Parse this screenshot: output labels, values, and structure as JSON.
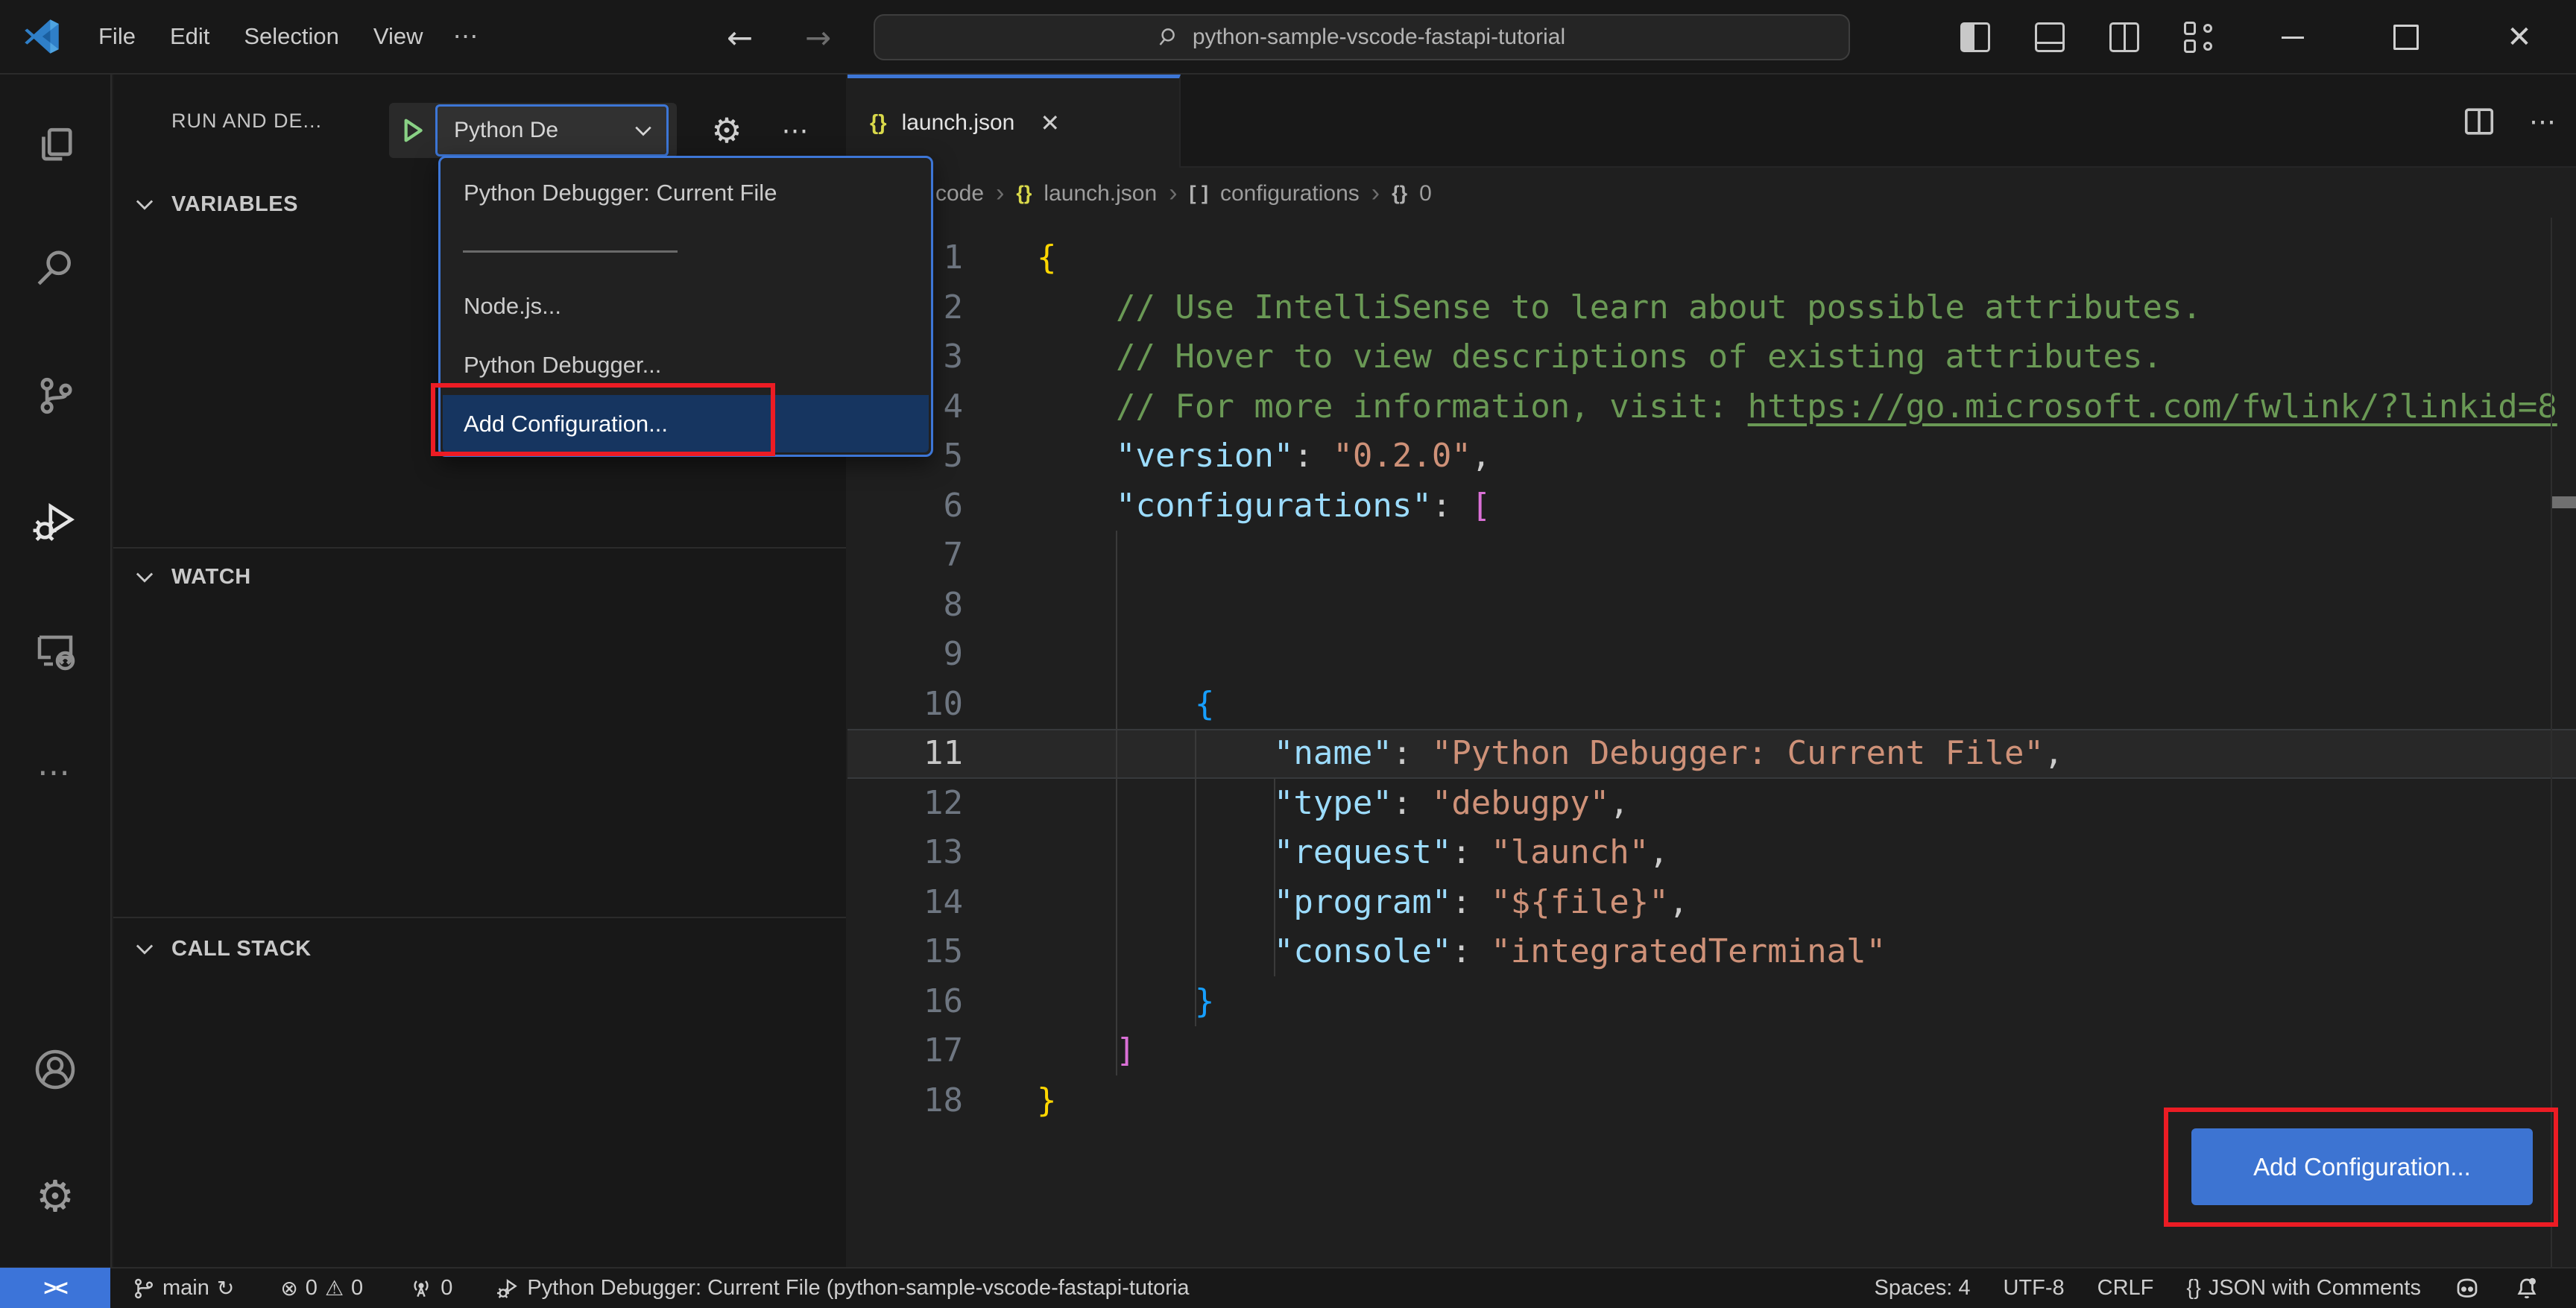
{
  "titlebar": {
    "menus": [
      "File",
      "Edit",
      "Selection",
      "View"
    ],
    "more_label": "⋯",
    "back_arrow": "←",
    "forward_arrow": "→",
    "search_value": "python-sample-vscode-fastapi-tutorial"
  },
  "activity_bar": {
    "items": [
      "explorer",
      "search",
      "source-control",
      "run-and-debug",
      "remote-explorer",
      "more"
    ],
    "bottom_items": [
      "account",
      "settings"
    ],
    "active_item": "run-and-debug",
    "settings_glyph": "⚙",
    "more_glyph": "⋯"
  },
  "sidebar": {
    "title": "RUN AND DE...",
    "run_select_value": "Python De",
    "gear_glyph": "⚙",
    "more_glyph": "⋯",
    "sections": [
      {
        "label": "VARIABLES"
      },
      {
        "label": "WATCH"
      },
      {
        "label": "CALL STACK"
      }
    ]
  },
  "debug_dropdown": {
    "items": [
      "Python Debugger: Current File",
      "Node.js...",
      "Python Debugger...",
      "Add Configuration..."
    ],
    "selected_item": "Add Configuration..."
  },
  "editor": {
    "tab": {
      "icon": "{}",
      "label": "launch.json",
      "close": "✕"
    },
    "breadcrumbs": [
      {
        "sym": "",
        "label": "code"
      },
      {
        "sym": "{}",
        "label": "launch.json"
      },
      {
        "sym": "[ ]",
        "label": "configurations"
      },
      {
        "sym": "{}",
        "label": "0"
      }
    ],
    "crumb_sep": "›",
    "current_line": 11,
    "lines": [
      [
        {
          "t": "{",
          "c": "b1"
        }
      ],
      [
        {
          "t": "    // Use IntelliSense to learn about possible attributes.",
          "c": "cm"
        }
      ],
      [
        {
          "t": "    // Hover to view descriptions of existing attributes.",
          "c": "cm"
        }
      ],
      [
        {
          "t": "    // For more information, visit: ",
          "c": "cm"
        },
        {
          "t": "https://go.microsoft.com/fwlink/?linkid=8",
          "c": "lk"
        }
      ],
      [
        {
          "t": "    ",
          "c": "p"
        },
        {
          "t": "\"version\"",
          "c": "k"
        },
        {
          "t": ": ",
          "c": "p"
        },
        {
          "t": "\"0.2.0\"",
          "c": "s"
        },
        {
          "t": ",",
          "c": "p"
        }
      ],
      [
        {
          "t": "    ",
          "c": "p"
        },
        {
          "t": "\"configurations\"",
          "c": "k"
        },
        {
          "t": ": ",
          "c": "p"
        },
        {
          "t": "[",
          "c": "b2"
        }
      ],
      [],
      [],
      [],
      [
        {
          "t": "        ",
          "c": "p"
        },
        {
          "t": "{",
          "c": "b3"
        }
      ],
      [
        {
          "t": "            ",
          "c": "p"
        },
        {
          "t": "\"name\"",
          "c": "k"
        },
        {
          "t": ": ",
          "c": "p"
        },
        {
          "t": "\"Python Debugger: Current File\"",
          "c": "s"
        },
        {
          "t": ",",
          "c": "p"
        }
      ],
      [
        {
          "t": "            ",
          "c": "p"
        },
        {
          "t": "\"type\"",
          "c": "k"
        },
        {
          "t": ": ",
          "c": "p"
        },
        {
          "t": "\"debugpy\"",
          "c": "s"
        },
        {
          "t": ",",
          "c": "p"
        }
      ],
      [
        {
          "t": "            ",
          "c": "p"
        },
        {
          "t": "\"request\"",
          "c": "k"
        },
        {
          "t": ": ",
          "c": "p"
        },
        {
          "t": "\"launch\"",
          "c": "s"
        },
        {
          "t": ",",
          "c": "p"
        }
      ],
      [
        {
          "t": "            ",
          "c": "p"
        },
        {
          "t": "\"program\"",
          "c": "k"
        },
        {
          "t": ": ",
          "c": "p"
        },
        {
          "t": "\"${file}\"",
          "c": "s"
        },
        {
          "t": ",",
          "c": "p"
        }
      ],
      [
        {
          "t": "            ",
          "c": "p"
        },
        {
          "t": "\"console\"",
          "c": "k"
        },
        {
          "t": ": ",
          "c": "p"
        },
        {
          "t": "\"integratedTerminal\"",
          "c": "s"
        }
      ],
      [
        {
          "t": "        ",
          "c": "p"
        },
        {
          "t": "}",
          "c": "b3"
        }
      ],
      [
        {
          "t": "    ",
          "c": "p"
        },
        {
          "t": "]",
          "c": "b2"
        }
      ],
      [
        {
          "t": "}",
          "c": "b1"
        }
      ]
    ],
    "add_config_button": "Add Configuration..."
  },
  "status_bar": {
    "remote_indicator": "><",
    "branch": "main",
    "sync_glyph": "↻",
    "error_glyph": "⊗",
    "errors": "0",
    "warning_glyph": "⚠",
    "warnings": "0",
    "ports": "0",
    "debug_status": "Python Debugger: Current File (python-sample-vscode-fastapi-tutoria",
    "spaces": "Spaces: 4",
    "encoding": "UTF-8",
    "eol": "CRLF",
    "language_icon": "{}",
    "language": "JSON with Comments"
  },
  "colors": {
    "accent": "#3d76d6",
    "annotation_red": "#ec1c24",
    "remote_blue": "#3c74d9",
    "button_blue": "#3d74d2",
    "comment_green": "#6a9955",
    "key_blue": "#9cdcfe",
    "string_salmon": "#ce9178"
  }
}
